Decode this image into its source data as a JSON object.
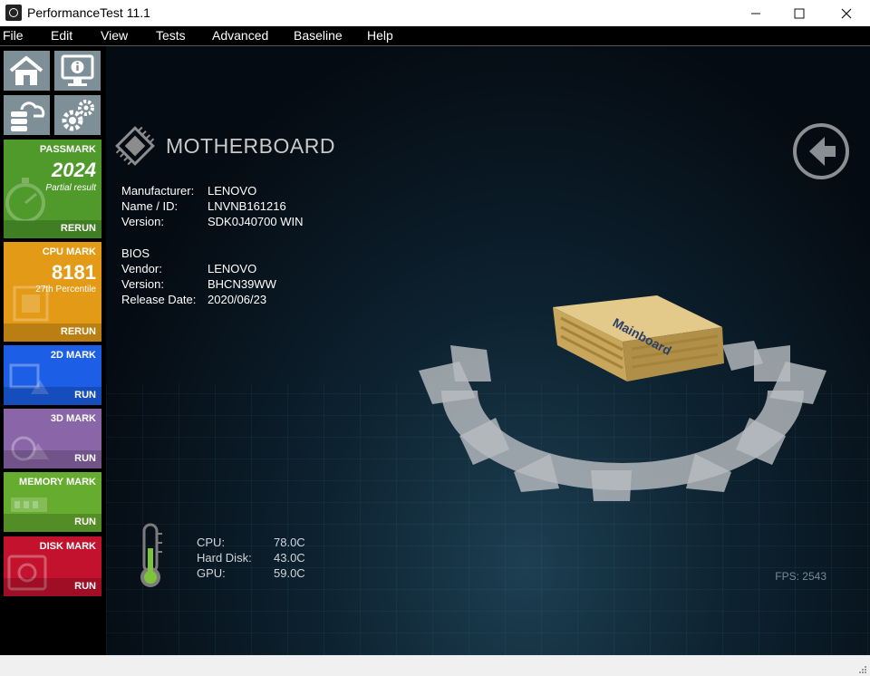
{
  "window": {
    "title": "PerformanceTest 11.1"
  },
  "menu": {
    "items": [
      "File",
      "Edit",
      "View",
      "Tests",
      "Advanced",
      "Baseline",
      "Help"
    ]
  },
  "sidebar": {
    "icons": [
      "home-icon",
      "system-info-icon",
      "cloud-database-icon",
      "settings-gears-icon"
    ],
    "tiles": [
      {
        "label": "PASSMARK",
        "score": "2024",
        "sub": "Partial result",
        "action": "RERUN",
        "color": "#4f9a2b"
      },
      {
        "label": "CPU MARK",
        "score": "8181",
        "sub": "27th Percentile",
        "action": "RERUN",
        "color": "#e39a16"
      },
      {
        "label": "2D MARK",
        "score": "",
        "sub": "",
        "action": "RUN",
        "color": "#1c5fe6"
      },
      {
        "label": "3D MARK",
        "score": "",
        "sub": "",
        "action": "RUN",
        "color": "#8a66a8"
      },
      {
        "label": "MEMORY MARK",
        "score": "",
        "sub": "",
        "action": "RUN",
        "color": "#66ac2e"
      },
      {
        "label": "DISK MARK",
        "score": "",
        "sub": "",
        "action": "RUN",
        "color": "#c2122e"
      }
    ]
  },
  "main": {
    "section_title": "MOTHERBOARD",
    "motherboard": [
      {
        "key": "Manufacturer:",
        "value": "LENOVO"
      },
      {
        "key": "Name / ID:",
        "value": "LNVNB161216"
      },
      {
        "key": "Version:",
        "value": "SDK0J40700 WIN"
      }
    ],
    "bios_heading": "BIOS",
    "bios": [
      {
        "key": "Vendor:",
        "value": "LENOVO"
      },
      {
        "key": "Version:",
        "value": "BHCN39WW"
      },
      {
        "key": "Release Date:",
        "value": "2020/06/23"
      }
    ],
    "chip_label": "Mainboard",
    "temperatures": [
      {
        "key": "CPU:",
        "value": "78.0C"
      },
      {
        "key": "Hard Disk:",
        "value": "43.0C"
      },
      {
        "key": "GPU:",
        "value": "59.0C"
      }
    ],
    "fps": "FPS: 2543"
  }
}
